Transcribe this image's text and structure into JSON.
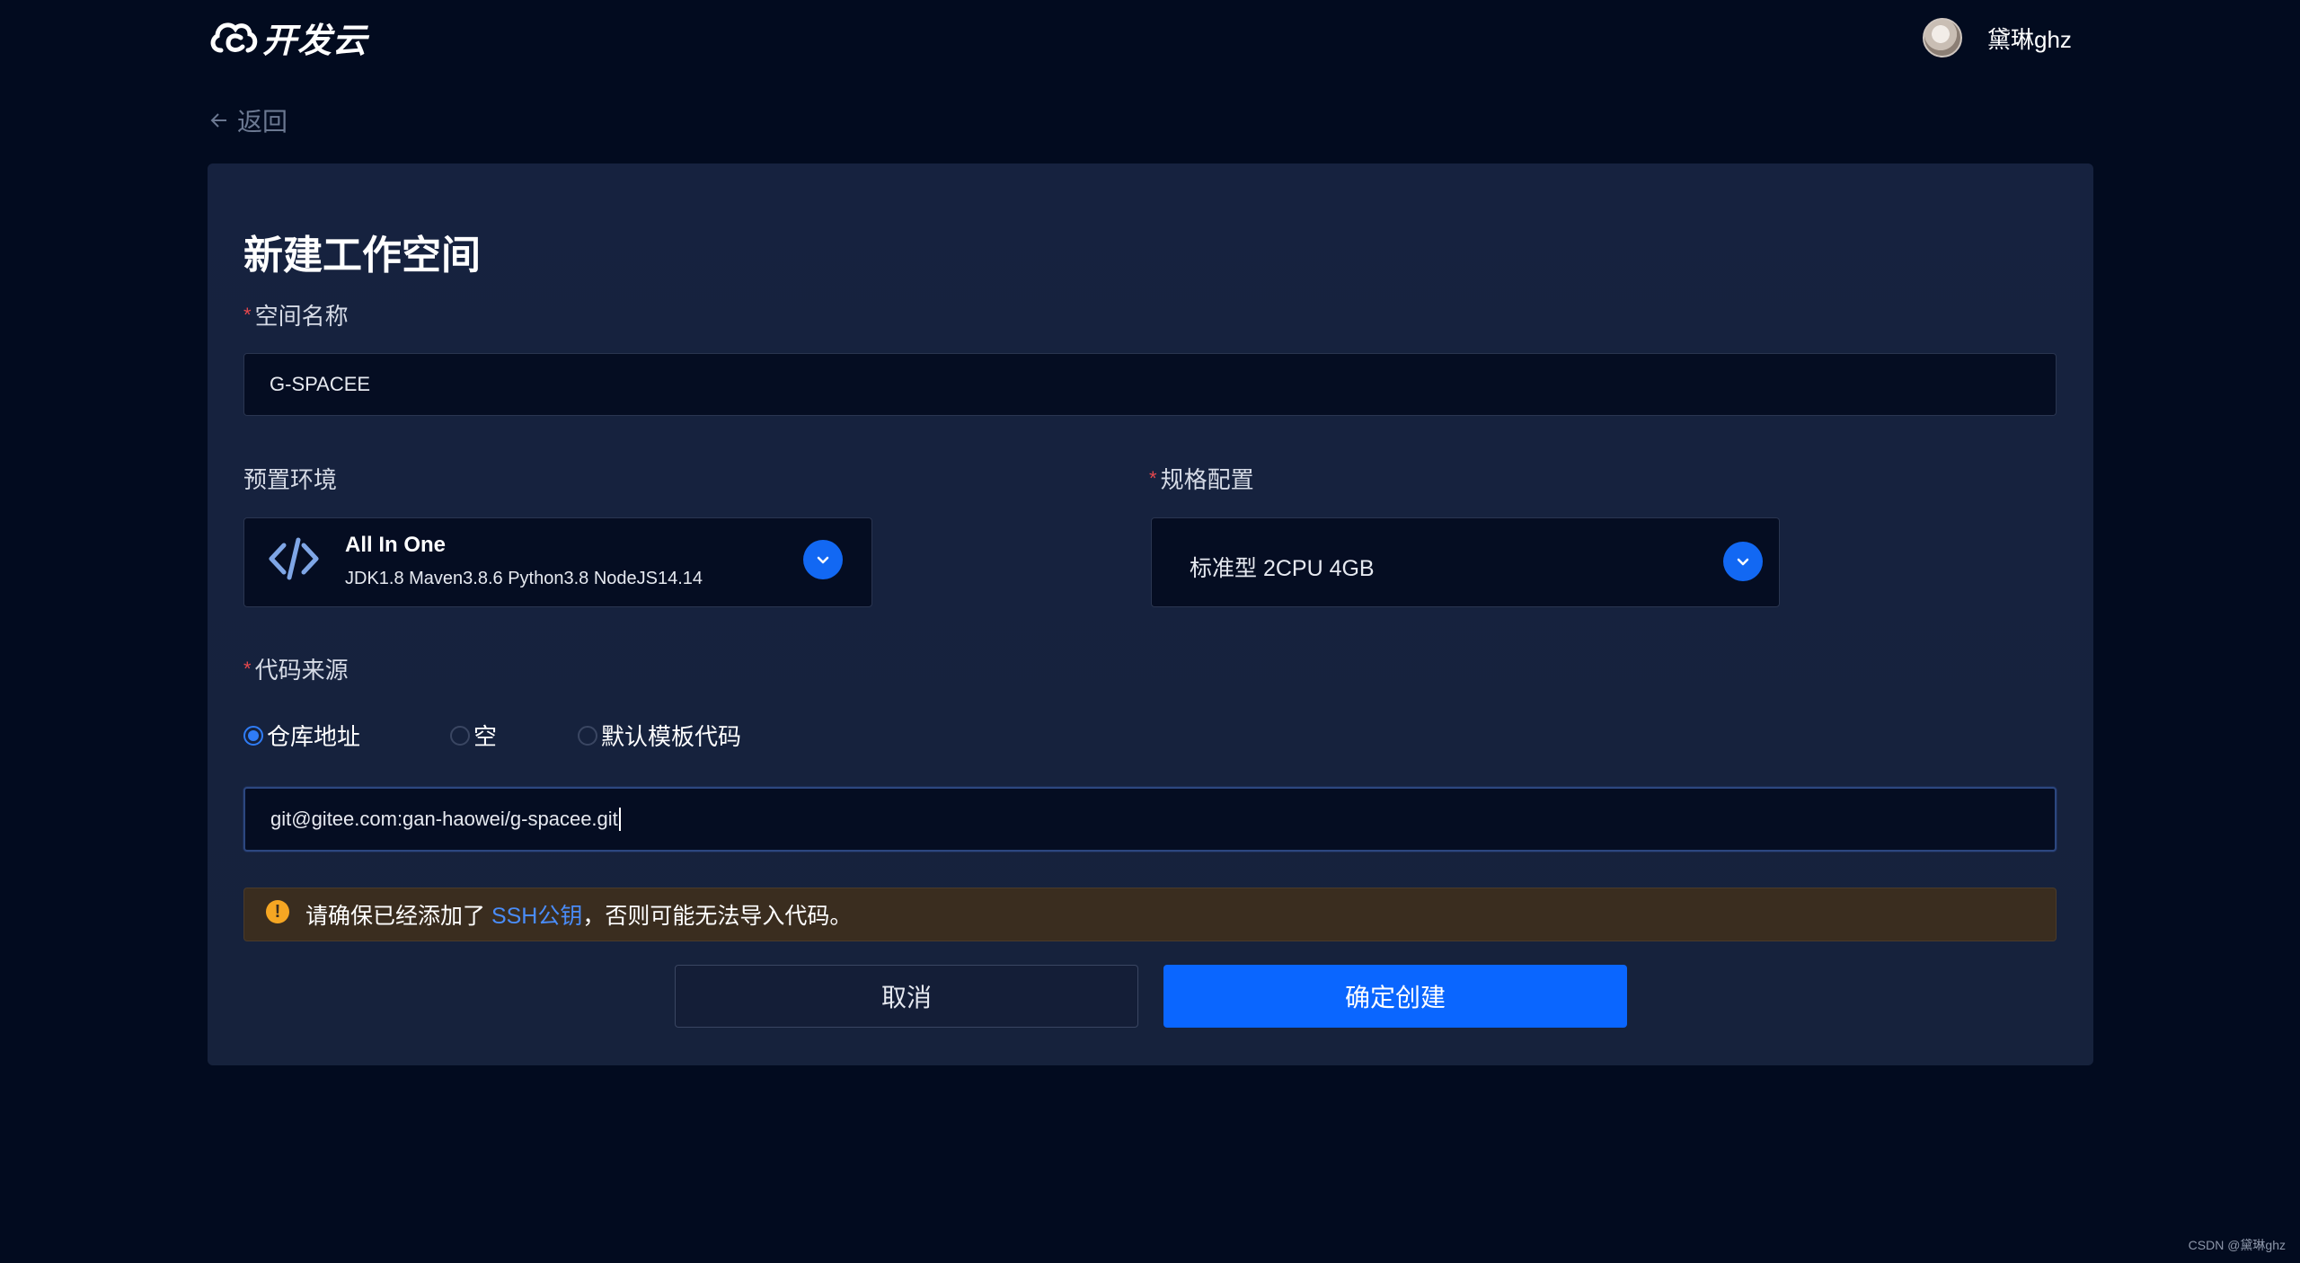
{
  "header": {
    "logo_text": "开发云",
    "logo_icon": "cloud-logo-icon",
    "username": "黛琳ghz"
  },
  "back": {
    "label": "返回",
    "icon": "arrow-left-icon"
  },
  "form": {
    "title": "新建工作空间",
    "space_name": {
      "label": "空间名称",
      "required_mark": "*",
      "value": "G-SPACEE"
    },
    "env": {
      "label": "预置环境",
      "icon": "code-brackets-icon",
      "name": "All In One",
      "description": "JDK1.8 Maven3.8.6 Python3.8 NodeJS14.14"
    },
    "spec": {
      "label": "规格配置",
      "required_mark": "*",
      "value": "标准型 2CPU 4GB"
    },
    "code_source": {
      "label": "代码来源",
      "required_mark": "*",
      "options": [
        "仓库地址",
        "空",
        "默认模板代码"
      ],
      "selected": "仓库地址",
      "repo_url": "git@gitee.com:gan-haowei/g-spacee.git"
    },
    "notice": {
      "icon": "warning-icon",
      "icon_glyph": "!",
      "prefix": "请确保已经添加了 ",
      "link": "SSH公钥",
      "suffix": "，否则可能无法导入代码。"
    },
    "buttons": {
      "cancel": "取消",
      "confirm": "确定创建"
    }
  },
  "watermark": "CSDN @黛琳ghz",
  "colors": {
    "background": "#020b1f",
    "card": "#16223f",
    "accent": "#0a66ff",
    "required": "#e5484d",
    "warning": "#f5a623"
  }
}
